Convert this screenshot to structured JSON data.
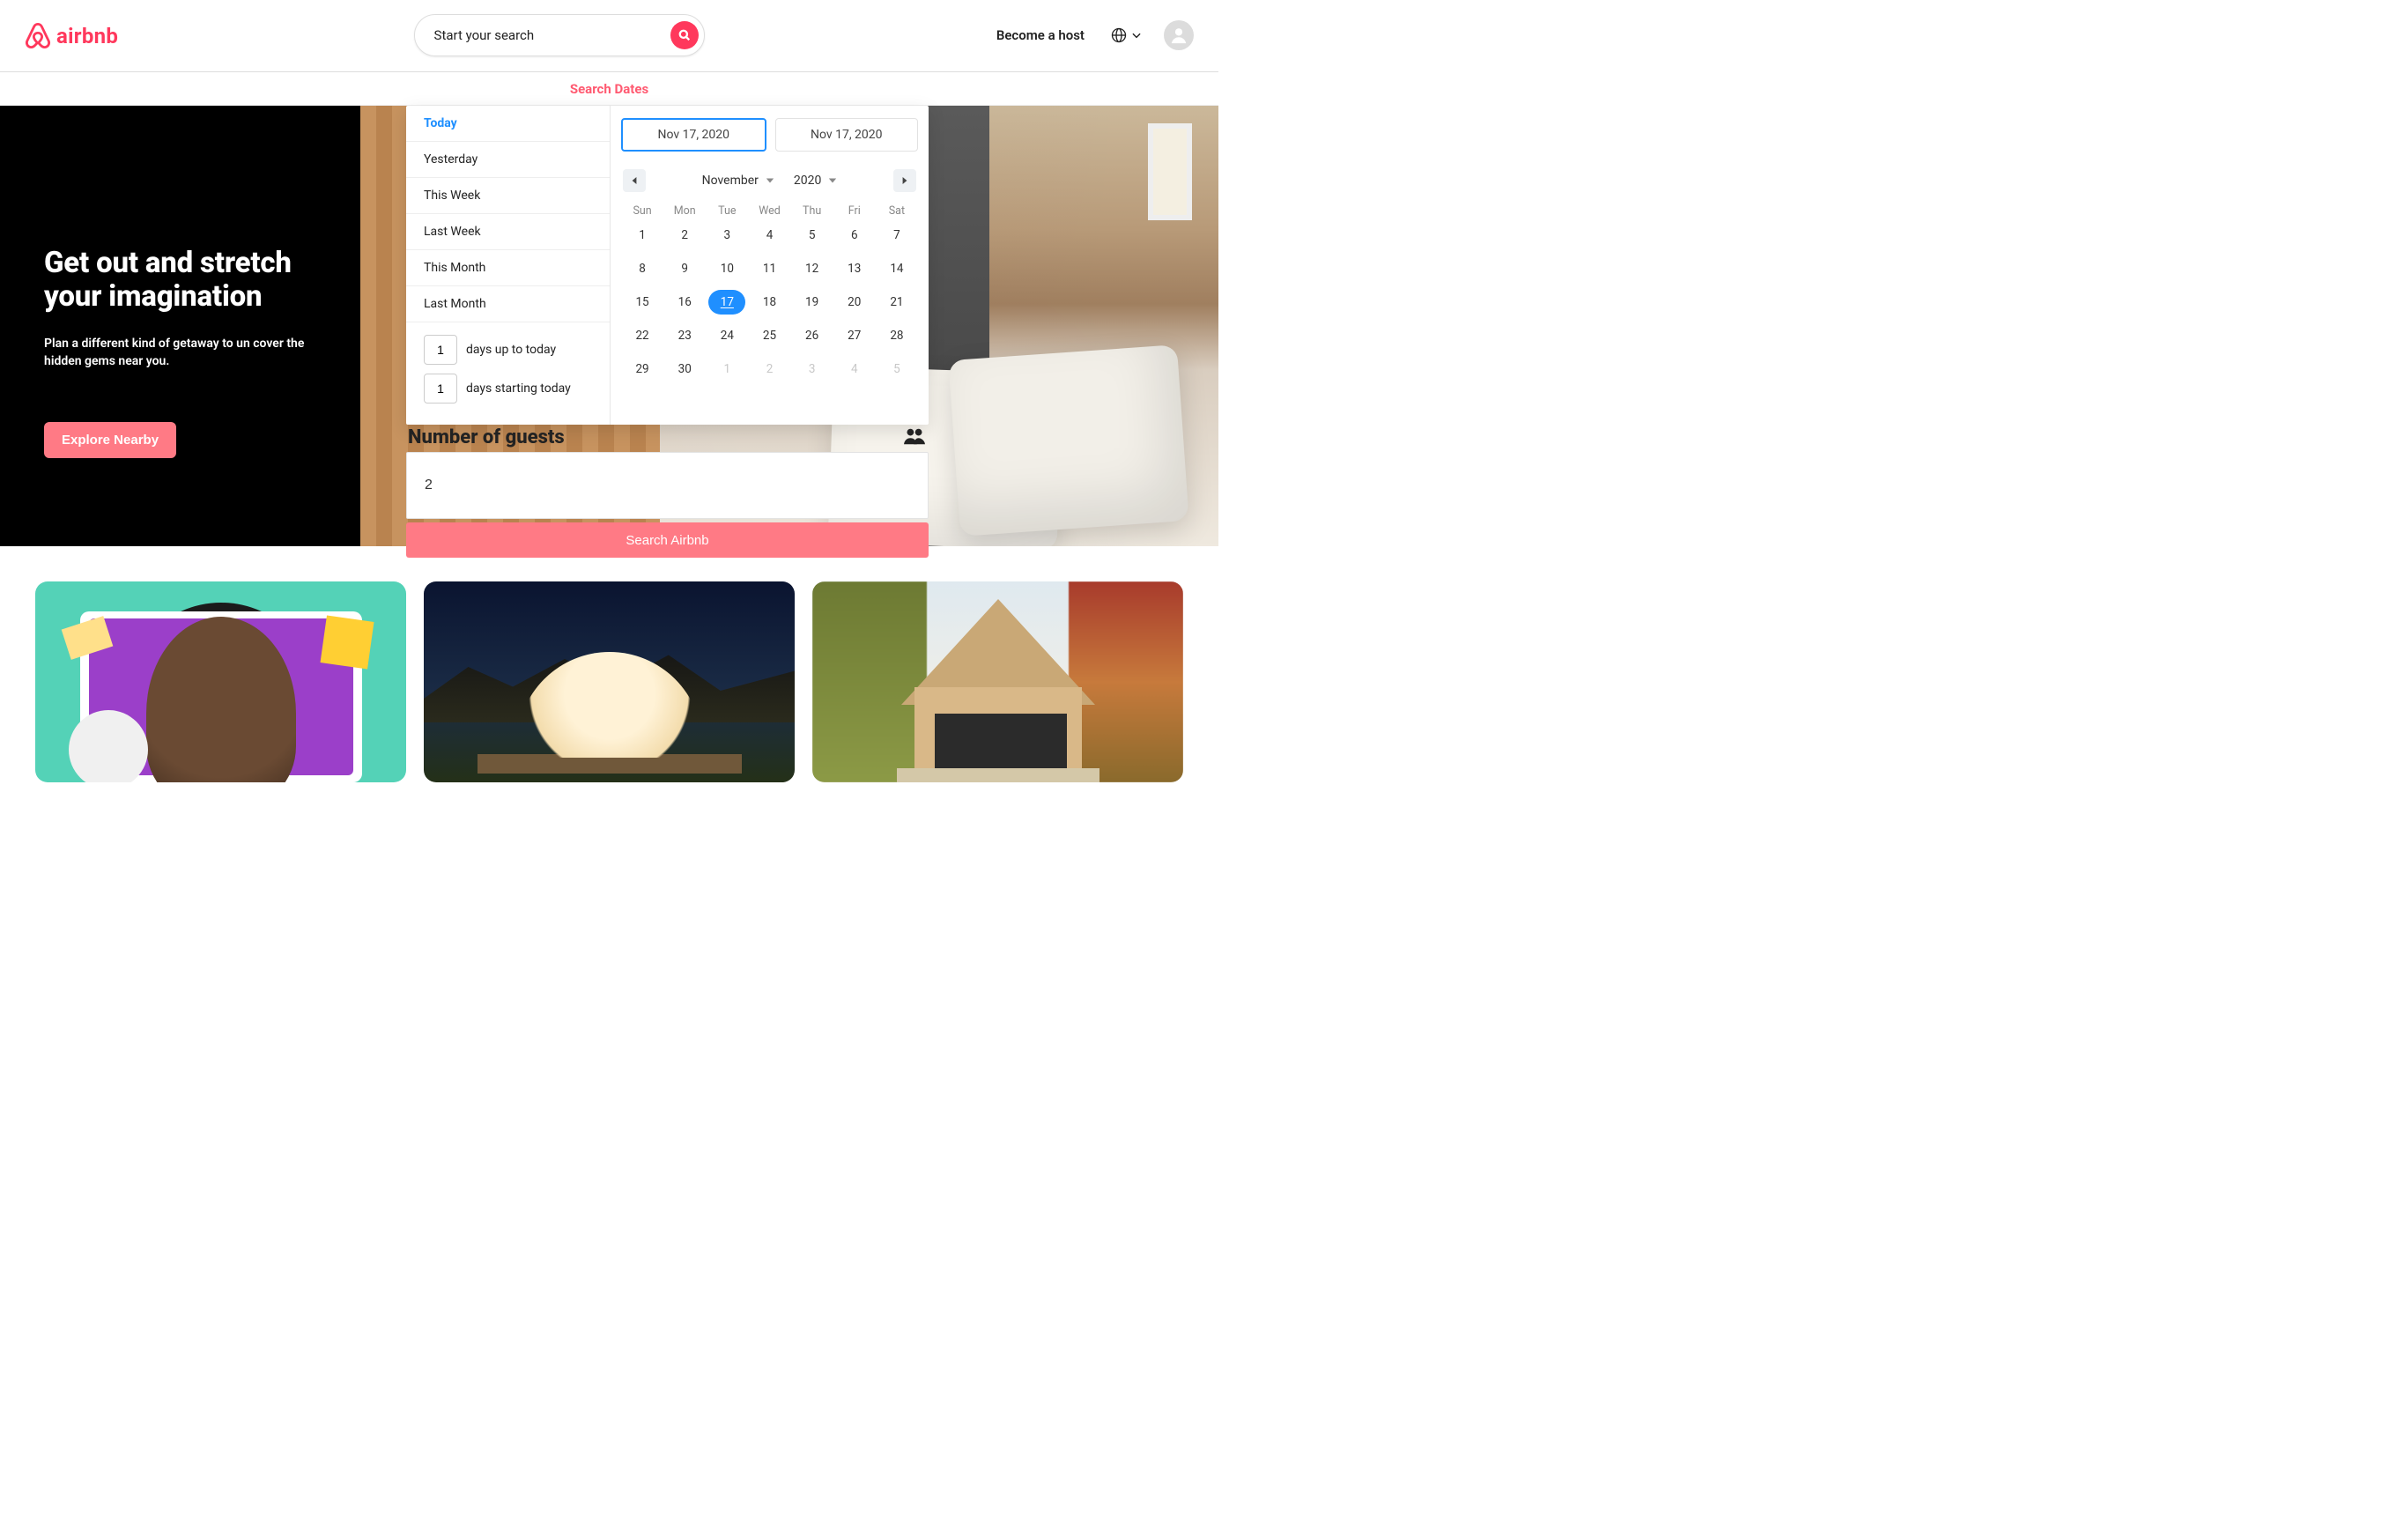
{
  "header": {
    "brand": "airbnb",
    "search_placeholder": "Start your search",
    "host_link": "Become a host"
  },
  "dates_bar": {
    "title": "Search Dates"
  },
  "hero": {
    "title_l1": "Get out and stretch",
    "title_l2": "your imagination",
    "subtitle": "Plan a different kind of getaway to un cover the hidden gems near you.",
    "explore": "Explore Nearby"
  },
  "panel": {
    "presets": [
      "Today",
      "Yesterday",
      "This Week",
      "Last Week",
      "This Month",
      "Last Month"
    ],
    "days_up_value": "1",
    "days_up_label": "days up to today",
    "days_start_value": "1",
    "days_start_label": "days starting today",
    "chip_start": "Nov 17, 2020",
    "chip_end": "Nov 17, 2020",
    "month": "November",
    "year": "2020",
    "dow": [
      "Sun",
      "Mon",
      "Tue",
      "Wed",
      "Thu",
      "Fri",
      "Sat"
    ],
    "weeks": [
      [
        {
          "n": "1"
        },
        {
          "n": "2"
        },
        {
          "n": "3"
        },
        {
          "n": "4"
        },
        {
          "n": "5"
        },
        {
          "n": "6"
        },
        {
          "n": "7"
        }
      ],
      [
        {
          "n": "8"
        },
        {
          "n": "9"
        },
        {
          "n": "10"
        },
        {
          "n": "11"
        },
        {
          "n": "12"
        },
        {
          "n": "13"
        },
        {
          "n": "14"
        }
      ],
      [
        {
          "n": "15"
        },
        {
          "n": "16"
        },
        {
          "n": "17",
          "sel": true
        },
        {
          "n": "18"
        },
        {
          "n": "19"
        },
        {
          "n": "20"
        },
        {
          "n": "21"
        }
      ],
      [
        {
          "n": "22"
        },
        {
          "n": "23"
        },
        {
          "n": "24"
        },
        {
          "n": "25"
        },
        {
          "n": "26"
        },
        {
          "n": "27"
        },
        {
          "n": "28"
        }
      ],
      [
        {
          "n": "29"
        },
        {
          "n": "30"
        },
        {
          "n": "1",
          "o": true
        },
        {
          "n": "2",
          "o": true
        },
        {
          "n": "3",
          "o": true
        },
        {
          "n": "4",
          "o": true
        },
        {
          "n": "5",
          "o": true
        }
      ]
    ],
    "guests_title": "Number of guests",
    "guests_value": "2",
    "search_label": "Search Airbnb"
  }
}
